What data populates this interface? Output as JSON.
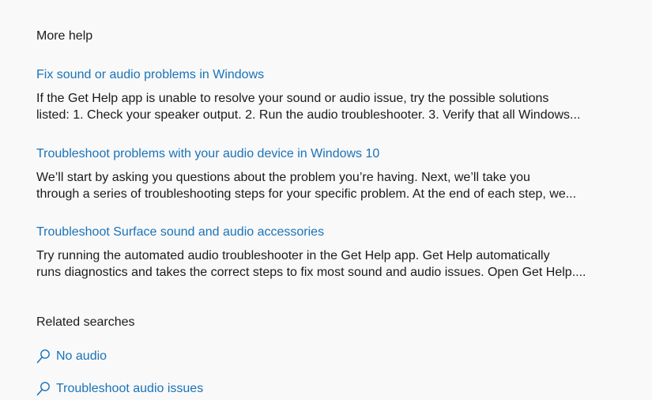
{
  "more_help": {
    "title": "More help",
    "results": [
      {
        "title": "Fix sound or audio problems in Windows",
        "desc_line1": "If the Get Help app is unable to resolve your sound or audio issue, try the possible solutions",
        "desc_line2": "listed: 1. Check your speaker output. 2. Run the audio troubleshooter. 3. Verify that all Windows..."
      },
      {
        "title": "Troubleshoot problems with your audio device in Windows 10",
        "desc_line1": "We’ll start by asking you questions about the problem you’re having. Next, we’ll take you",
        "desc_line2": "through a series of troubleshooting steps for your specific problem. At the end of each step, we..."
      },
      {
        "title": "Troubleshoot Surface sound and audio accessories",
        "desc_line1": "Try running the automated audio troubleshooter in the Get Help app. Get Help automatically",
        "desc_line2": "runs diagnostics and takes the correct steps to fix most sound and audio issues. Open Get Help...."
      }
    ]
  },
  "related_searches": {
    "title": "Related searches",
    "icon": "search-icon",
    "items": [
      {
        "label": "No audio"
      },
      {
        "label": "Troubleshoot audio issues"
      }
    ]
  },
  "colors": {
    "link": "#1a73b8",
    "text": "#1b1b1b",
    "background": "#f9f9f9"
  }
}
